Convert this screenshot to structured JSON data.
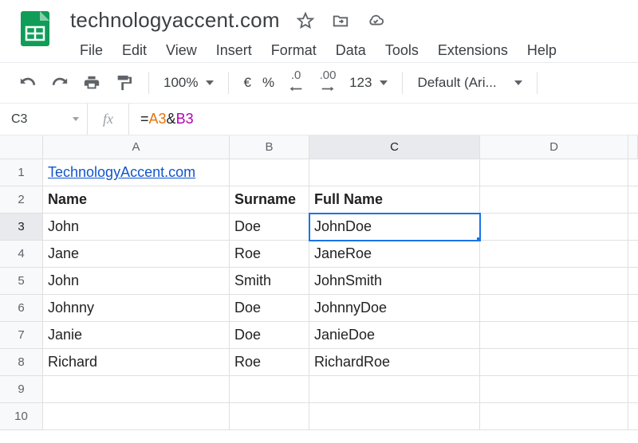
{
  "doc": {
    "title": "technologyaccent.com"
  },
  "menubar": {
    "items": [
      "File",
      "Edit",
      "View",
      "Insert",
      "Format",
      "Data",
      "Tools",
      "Extensions",
      "Help"
    ]
  },
  "toolbar": {
    "zoom": "100%",
    "currency": "€",
    "percent": "%",
    "dec_dec": ".0",
    "inc_dec": ".00",
    "numfmt": "123",
    "font": "Default (Ari..."
  },
  "formula": {
    "namebox": "C3",
    "fx": "fx",
    "eq": "=",
    "refA": "A3",
    "amp": "&",
    "refB": "B3"
  },
  "columns": [
    "A",
    "B",
    "C",
    "D",
    ""
  ],
  "rows": [
    "1",
    "2",
    "3",
    "4",
    "5",
    "6",
    "7",
    "8",
    "9",
    "10"
  ],
  "cells": {
    "A1": "TechnologyAccent.com",
    "A2": "Name",
    "B2": "Surname",
    "C2": "Full Name",
    "A3": "John",
    "B3": "Doe",
    "C3": "JohnDoe",
    "A4": "Jane",
    "B4": "Roe",
    "C4": "JaneRoe",
    "A5": "John",
    "B5": "Smith",
    "C5": "JohnSmith",
    "A6": "Johnny",
    "B6": "Doe",
    "C6": "JohnnyDoe",
    "A7": "Janie",
    "B7": "Doe",
    "C7": "JanieDoe",
    "A8": "Richard",
    "B8": "Roe",
    "C8": "RichardRoe"
  },
  "selection": {
    "cell": "C3",
    "row": "3",
    "col": "C"
  }
}
